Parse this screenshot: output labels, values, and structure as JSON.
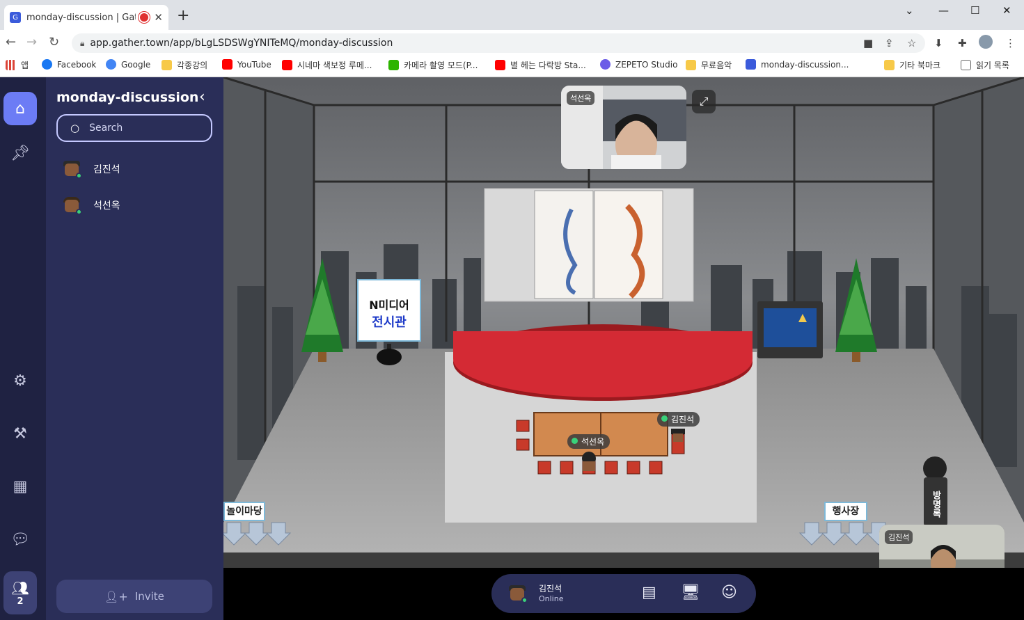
{
  "browser": {
    "tab_title": "monday-discussion | Gather",
    "tab_close": "✕",
    "new_tab": "+",
    "url": "app.gather.town/app/bLgLSDSWgYNITeMQ/monday-discussion",
    "window_controls": {
      "minimize": "⌄",
      "restore": "—",
      "maximize": "☐",
      "close": "✕"
    }
  },
  "bookmarks": [
    {
      "label": "앱",
      "color": "#db4437"
    },
    {
      "label": "Facebook",
      "color": "#1877f2"
    },
    {
      "label": "Google",
      "color": "#4285f4"
    },
    {
      "label": "각종강의",
      "color": "#f7c948"
    },
    {
      "label": "YouTube",
      "color": "#ff0000"
    },
    {
      "label": "시네마 색보정 루메...",
      "color": "#ff0000"
    },
    {
      "label": "카메라 촬영 모드(P...",
      "color": "#2db400"
    },
    {
      "label": "별 헤는 다락방 Sta...",
      "color": "#ff0000"
    },
    {
      "label": "ZEPETO Studio",
      "color": "#6c5ce7"
    },
    {
      "label": "무료음악",
      "color": "#f7c948"
    },
    {
      "label": "monday-discussion...",
      "color": "#3b5bdb"
    },
    {
      "label": "기타 북마크",
      "color": "#f7c948"
    },
    {
      "label": "읽기 목록",
      "color": "#666666"
    }
  ],
  "sidebar": {
    "room_title": "monday-discussion",
    "search_placeholder": "Search",
    "members": [
      {
        "name": "김진석"
      },
      {
        "name": "석선옥"
      }
    ],
    "invite_label": "Invite",
    "participants_count": "2"
  },
  "map": {
    "sign_top": "N미디어",
    "sign_bottom": "전시관",
    "portal_left": "놀이마당",
    "portal_right": "행사장",
    "portal_vertical": "방명록",
    "players": [
      {
        "name": "김진석"
      },
      {
        "name": "석선옥"
      }
    ]
  },
  "videos": {
    "top_name": "석선옥",
    "bottom_name": "김진석"
  },
  "statusbar": {
    "name": "김진석",
    "status": "Online"
  },
  "colors": {
    "rail": "#1f2242",
    "panel": "#2a2e58",
    "accent": "#6c7cf5",
    "online": "#3ad17a"
  }
}
